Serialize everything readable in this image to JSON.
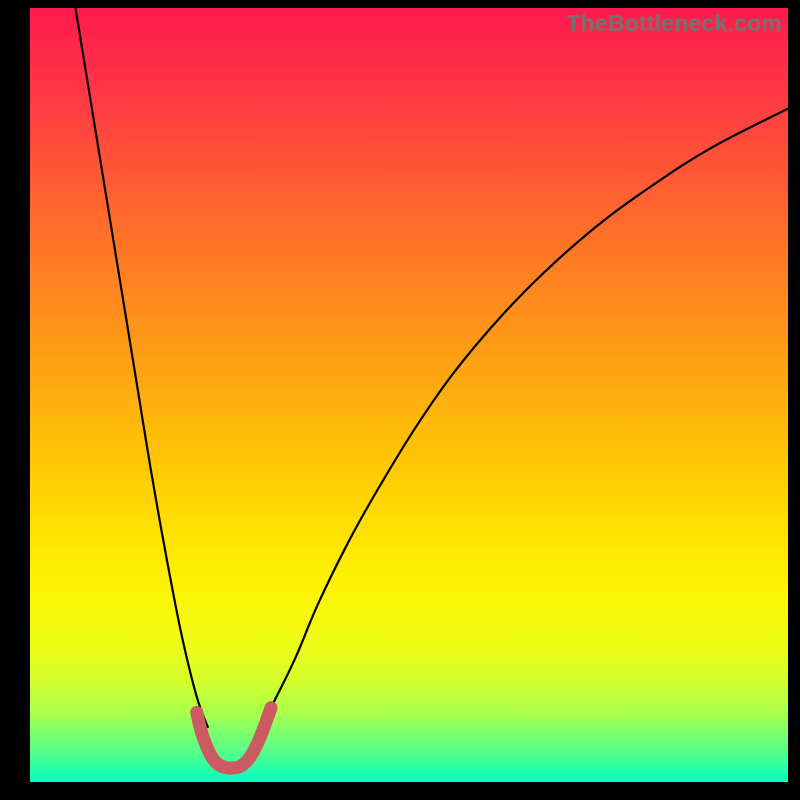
{
  "watermark": "TheBottleneck.com",
  "chart_data": {
    "type": "line",
    "title": "",
    "xlabel": "",
    "ylabel": "",
    "xlim": [
      0,
      100
    ],
    "ylim": [
      0,
      100
    ],
    "grid": false,
    "legend": false,
    "annotations": [],
    "series": [
      {
        "name": "curve-left",
        "color": "#000000",
        "stroke_width": 2.2,
        "x": [
          6,
          8,
          10,
          12,
          14,
          16,
          18,
          20,
          22,
          23.5
        ],
        "y": [
          100,
          88,
          76,
          64,
          52,
          40,
          29,
          19,
          11,
          7
        ]
      },
      {
        "name": "curve-right",
        "color": "#000000",
        "stroke_width": 2.2,
        "x": [
          30,
          32,
          35,
          38,
          42,
          46,
          51,
          56,
          62,
          68,
          75,
          82,
          90,
          100
        ],
        "y": [
          6,
          10,
          16,
          23,
          31,
          38,
          46,
          53,
          60,
          66,
          72,
          77,
          82,
          87
        ]
      },
      {
        "name": "bottom-highlight",
        "color": "#cc5a63",
        "stroke_width": 13,
        "linecap": "round",
        "x": [
          22.0,
          22.6,
          23.3,
          24.0,
          24.8,
          25.7,
          26.7,
          27.7,
          28.6,
          29.4,
          30.2,
          31.0,
          31.8
        ],
        "y": [
          9.0,
          6.5,
          4.6,
          3.2,
          2.3,
          1.9,
          1.8,
          2.0,
          2.7,
          3.8,
          5.4,
          7.4,
          9.6
        ]
      }
    ]
  }
}
